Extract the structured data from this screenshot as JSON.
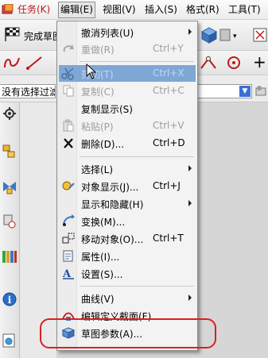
{
  "menubar": {
    "items": [
      {
        "label": "任务(K)"
      },
      {
        "label": "编辑(E)"
      },
      {
        "label": "视图(V)"
      },
      {
        "label": "插入(S)"
      },
      {
        "label": "格式(R)"
      },
      {
        "label": "工具(T)"
      }
    ]
  },
  "toolbar": {
    "finish_sketch_label": "完成草图",
    "filter_label": "没有选择过滤"
  },
  "edit_menu": {
    "items": [
      {
        "label": "撤消列表(U)",
        "shortcut": "",
        "submenu": true
      },
      {
        "label": "重做(R)",
        "shortcut": "Ctrl+Y",
        "disabled": true
      },
      {
        "label": "剪切(T)",
        "shortcut": "Ctrl+X",
        "disabled": true,
        "highlighted": true
      },
      {
        "label": "复制(C)",
        "shortcut": "Ctrl+C",
        "disabled": true
      },
      {
        "label": "复制显示(S)",
        "shortcut": ""
      },
      {
        "label": "粘贴(P)",
        "shortcut": "Ctrl+V",
        "disabled": true
      },
      {
        "label": "删除(D)...",
        "shortcut": "Ctrl+D"
      },
      {
        "label": "选择(L)",
        "shortcut": "",
        "submenu": true
      },
      {
        "label": "对象显示(J)...",
        "shortcut": "Ctrl+J"
      },
      {
        "label": "显示和隐藏(H)",
        "shortcut": "",
        "submenu": true
      },
      {
        "label": "变换(M)...",
        "shortcut": ""
      },
      {
        "label": "移动对象(O)...",
        "shortcut": "Ctrl+T"
      },
      {
        "label": "属性(I)...",
        "shortcut": ""
      },
      {
        "label": "设置(S)...",
        "shortcut": ""
      },
      {
        "label": "曲线(V)",
        "shortcut": "",
        "submenu": true
      },
      {
        "label": "编辑定义截面(F)...",
        "shortcut": ""
      },
      {
        "label": "草图参数(A)...",
        "shortcut": ""
      }
    ]
  },
  "colors": {
    "highlight_ring": "#d82020",
    "menu_hover": "#7ea7d6",
    "task_menu_text": "#c01818"
  }
}
